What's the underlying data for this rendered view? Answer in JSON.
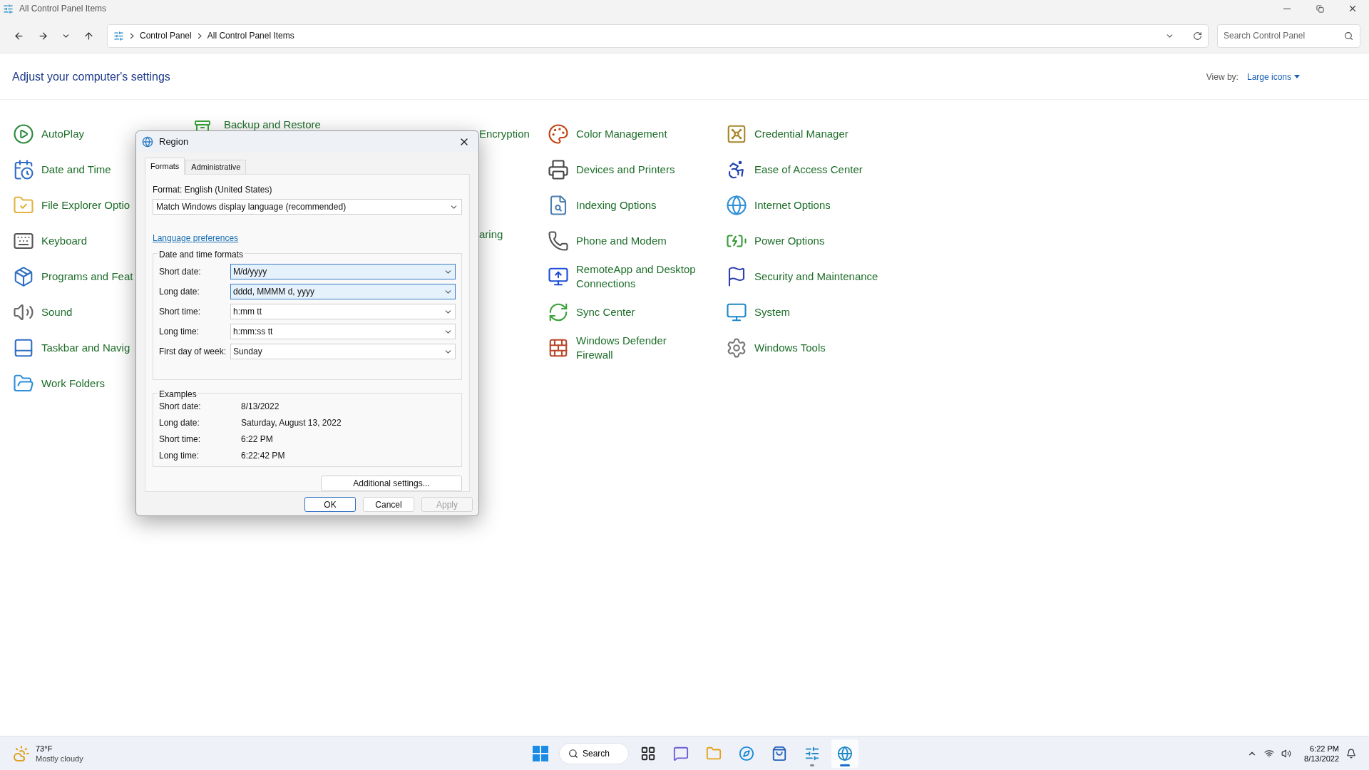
{
  "window": {
    "title": "All Control Panel Items"
  },
  "address_bar": {
    "breadcrumbs": [
      "Control Panel",
      "All Control Panel Items"
    ]
  },
  "search": {
    "placeholder": "Search Control Panel"
  },
  "heading": "Adjust your computer's settings",
  "view_by": {
    "label": "View by:",
    "value": "Large icons"
  },
  "columns": [
    {
      "items": [
        "AutoPlay",
        "Date and Time",
        "File Explorer Optio",
        "Keyboard",
        "Programs and Feat",
        "Sound",
        "Taskbar and Navig",
        "Work Folders"
      ]
    },
    {
      "items": [
        "Color Management",
        "Devices and Printers",
        "Indexing Options",
        "Phone and Modem",
        "RemoteApp and Desktop Connections",
        "Sync Center",
        "Windows Defender Firewall"
      ]
    },
    {
      "items": [
        "Credential Manager",
        "Ease of Access Center",
        "Internet Options",
        "Power Options",
        "Security and Maintenance",
        "System",
        "Windows Tools"
      ]
    }
  ],
  "partly_hidden_items": [
    "Backup and Restore",
    "Encryption",
    "aring"
  ],
  "dialog": {
    "title": "Region",
    "tabs": [
      {
        "label": "Formats",
        "selected": true
      },
      {
        "label": "Administrative",
        "selected": false
      }
    ],
    "format_label": "Format: English (United States)",
    "format_select": {
      "value": "Match Windows display language (recommended)"
    },
    "link": "Language preferences",
    "formats_group": {
      "title": "Date and time formats",
      "rows": [
        {
          "label": "Short date:",
          "value": "M/d/yyyy",
          "highlighted": true
        },
        {
          "label": "Long date:",
          "value": "dddd, MMMM d, yyyy",
          "highlighted": true
        },
        {
          "label": "Short time:",
          "value": "h:mm tt",
          "highlighted": false
        },
        {
          "label": "Long time:",
          "value": "h:mm:ss tt",
          "highlighted": false
        },
        {
          "label": "First day of week:",
          "value": "Sunday",
          "highlighted": false
        }
      ]
    },
    "examples_group": {
      "title": "Examples",
      "rows": [
        {
          "label": "Short date:",
          "value": "8/13/2022"
        },
        {
          "label": "Long date:",
          "value": "Saturday, August 13, 2022"
        },
        {
          "label": "Short time:",
          "value": "6:22 PM"
        },
        {
          "label": "Long time:",
          "value": "6:22:42 PM"
        }
      ]
    },
    "additional_button": "Additional settings...",
    "buttons": [
      {
        "label": "OK",
        "default": true,
        "disabled": false
      },
      {
        "label": "Cancel",
        "default": false,
        "disabled": false
      },
      {
        "label": "Apply",
        "default": false,
        "disabled": true
      }
    ]
  },
  "taskbar": {
    "weather": {
      "temperature": "73°F",
      "condition": "Mostly cloudy"
    },
    "search_button": "Search",
    "apps": [
      {
        "kind": "taskview",
        "running": false,
        "selected": false
      },
      {
        "kind": "chat",
        "running": false,
        "selected": false
      },
      {
        "kind": "explorer",
        "running": false,
        "selected": false
      },
      {
        "kind": "browser",
        "running": false,
        "selected": false
      },
      {
        "kind": "store",
        "running": false,
        "selected": false
      },
      {
        "kind": "panel",
        "running": true,
        "selected": false
      },
      {
        "kind": "globe",
        "running": true,
        "selected": true
      }
    ],
    "clock": {
      "time": "6:22 PM",
      "date": "8/13/2022"
    }
  }
}
